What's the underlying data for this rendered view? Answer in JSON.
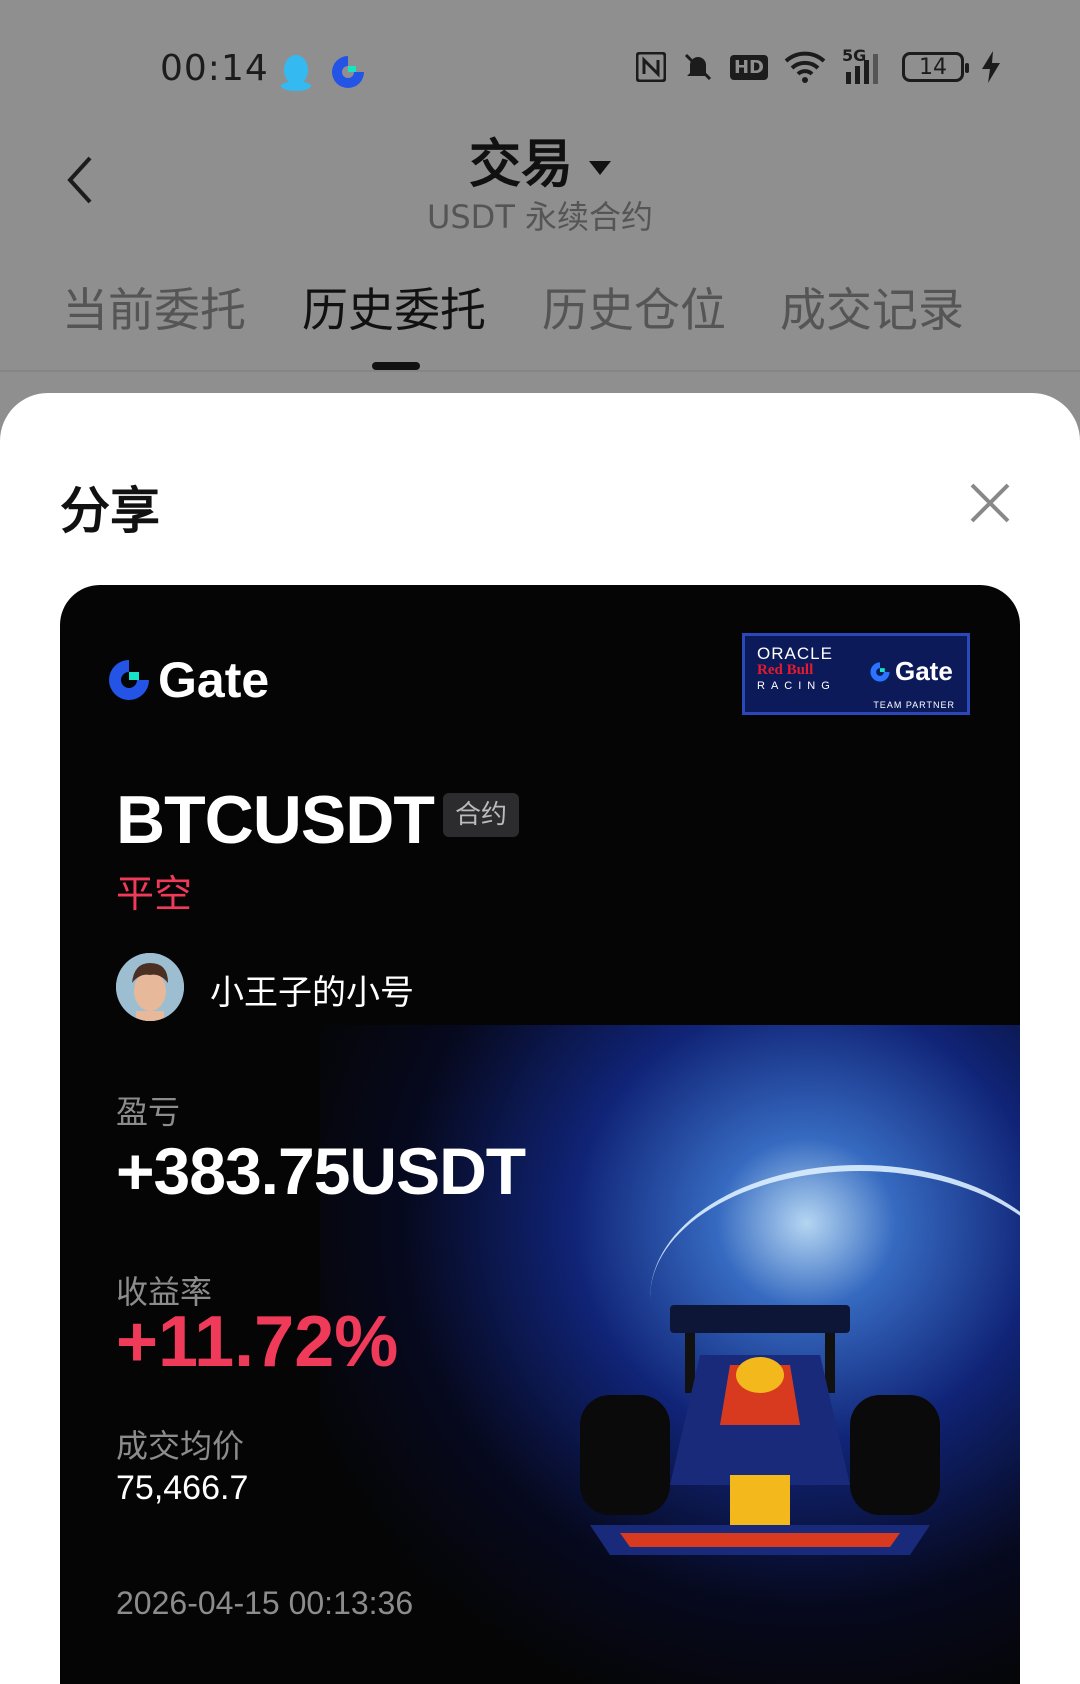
{
  "status_bar": {
    "time": "00:14",
    "battery": "14",
    "icons": [
      "qq-icon",
      "gate-app-icon",
      "nfc-icon",
      "mute-icon",
      "hd-icon",
      "wifi-icon",
      "signal-5g-icon",
      "battery-icon",
      "charging-icon"
    ],
    "network": "5G",
    "hd": "HD"
  },
  "header": {
    "title": "交易",
    "subtitle": "USDT 永续合约"
  },
  "tabs": [
    {
      "label": "当前委托"
    },
    {
      "label": "历史委托",
      "active": true
    },
    {
      "label": "历史仓位"
    },
    {
      "label": "成交记录"
    }
  ],
  "share_sheet": {
    "title": "分享"
  },
  "card": {
    "brand": "Gate",
    "partner": {
      "oracle": "ORACLE",
      "redbull": "Red Bull",
      "racing": "RACING",
      "brand": "Gate",
      "team": "TEAM PARTNER"
    },
    "symbol": "BTCUSDT",
    "contract_badge": "合约",
    "side": "平空",
    "username": "小王子的小号",
    "pnl_label": "盈亏",
    "pnl_value": "+383.75USDT",
    "roi_label": "收益率",
    "roi_value": "+11.72%",
    "avg_price_label": "成交均价",
    "avg_price_value": "75,466.7",
    "timestamp": "2026-04-15 00:13:36",
    "colors": {
      "negative_red": "#f03a5a",
      "brand_blue": "#2354e6",
      "brand_teal": "#17e3c6"
    }
  }
}
